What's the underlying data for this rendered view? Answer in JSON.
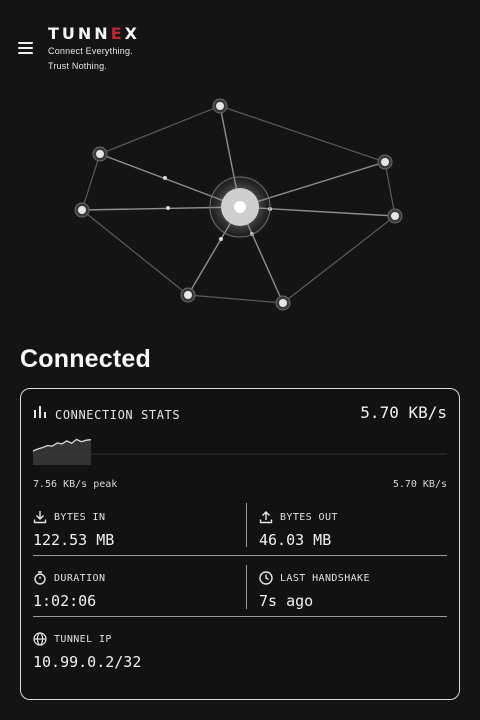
{
  "brand": {
    "logo_start": "TUNN",
    "logo_accent": "E",
    "logo_end": "X",
    "tagline_line1": "Connect Everything.",
    "tagline_line2": "Trust Nothing."
  },
  "status": {
    "title": "Connected"
  },
  "stats": {
    "title": "CONNECTION STATS",
    "current_speed": "5.70 KB/s",
    "peak_label": "7.56 KB/s peak",
    "current_label": "5.70 KB/s",
    "bytes_in_label": "BYTES IN",
    "bytes_in_value": "122.53 MB",
    "bytes_out_label": "BYTES OUT",
    "bytes_out_value": "46.03 MB",
    "duration_label": "DURATION",
    "duration_value": "1:02:06",
    "handshake_label": "LAST HANDSHAKE",
    "handshake_value": "7s ago",
    "tunnel_ip_label": "TUNNEL IP",
    "tunnel_ip_value": "10.99.0.2/32"
  },
  "icons": {
    "menu": "hamburger-icon",
    "stats": "bar-chart-icon",
    "bytes_in": "download-icon",
    "bytes_out": "upload-icon",
    "duration": "stopwatch-icon",
    "handshake": "clock-icon",
    "tunnel_ip": "globe-icon"
  },
  "colors": {
    "background": "#141414",
    "accent": "#c0262d",
    "text": "#f2f2f2",
    "card_border": "#d8d8d8"
  },
  "sparkline": {
    "peak": 7.56,
    "current": 5.7,
    "samples": [
      1.2,
      2.0,
      2.6,
      3.4,
      3.1,
      4.4,
      4.0,
      5.2,
      4.3,
      5.8,
      4.9,
      5.5,
      5.7
    ]
  }
}
